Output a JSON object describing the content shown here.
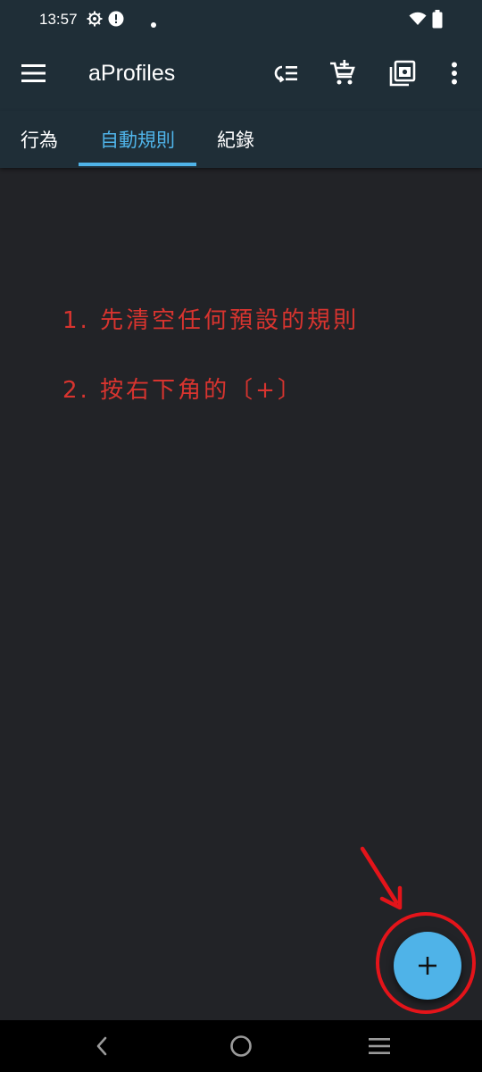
{
  "status_bar": {
    "time": "13:57"
  },
  "app_bar": {
    "title": "aProfiles"
  },
  "tabs": [
    {
      "label": "行為"
    },
    {
      "label": "自動規則"
    },
    {
      "label": "紀錄"
    }
  ],
  "annotations": {
    "step1": "1. 先清空任何預設的規則",
    "step2": "2. 按右下角的〔+〕"
  },
  "fab": {
    "label": "+"
  },
  "icons": {
    "status": [
      "settings-gear-icon",
      "alert-icon",
      "notification-dot-icon",
      "wifi-icon",
      "battery-icon"
    ],
    "app_bar": [
      "menu-icon",
      "queue-list-icon",
      "add-to-cart-icon",
      "gallery-badge-icon",
      "more-vert-icon"
    ],
    "nav": [
      "back-icon",
      "home-icon",
      "recents-icon"
    ]
  },
  "colors": {
    "app_bar_bg": "#1f2e37",
    "content_bg": "#222327",
    "accent": "#4fb3e8",
    "annotation_red": "#d8342f"
  }
}
